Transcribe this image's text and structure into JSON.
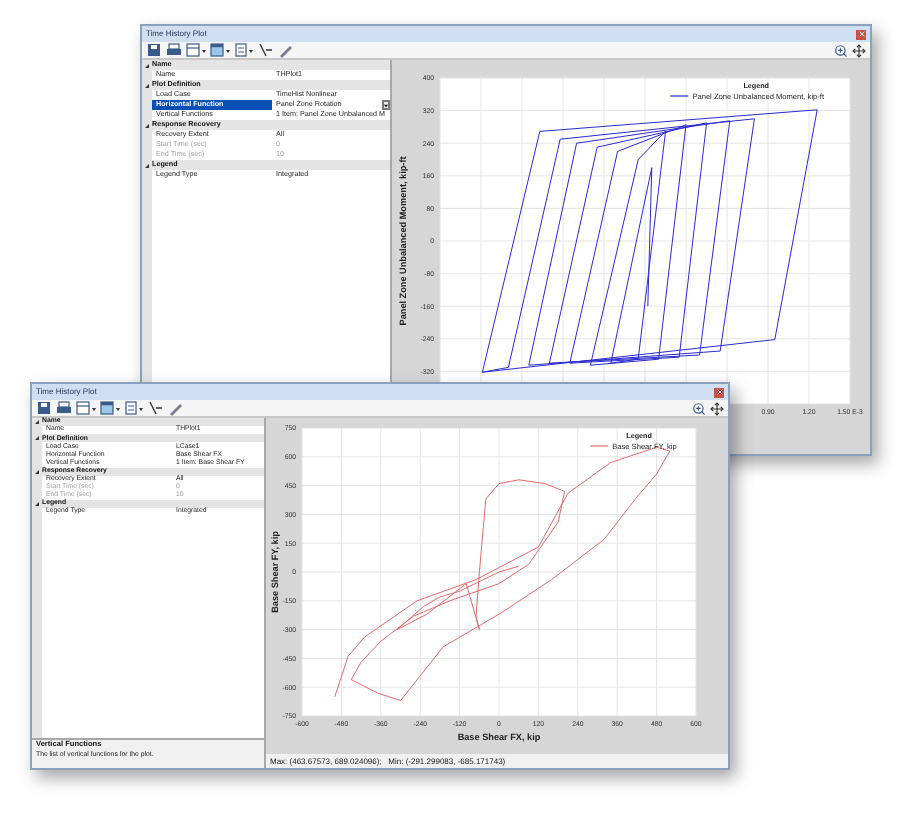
{
  "windows": [
    {
      "title": "Time History Plot",
      "properties": [
        {
          "title": "Name",
          "expanded": true,
          "items": [
            {
              "label": "Name",
              "value": "THPlot1",
              "disabled": false,
              "selected": false
            }
          ]
        },
        {
          "title": "Plot Definition",
          "expanded": true,
          "items": [
            {
              "label": "Load Case",
              "value": "TimeHist Nonlinear",
              "disabled": false,
              "selected": false
            },
            {
              "label": "Horizontal Function",
              "value": "Panel Zone Rotation",
              "disabled": false,
              "selected": true
            },
            {
              "label": "Vertical Functions",
              "value": "1 Item: Panel Zone Unbalanced M",
              "disabled": false,
              "selected": false
            }
          ]
        },
        {
          "title": "Response Recovery",
          "expanded": true,
          "items": [
            {
              "label": "Recovery Extent",
              "value": "All",
              "disabled": false,
              "selected": false
            },
            {
              "label": "Start Time (sec)",
              "value": "0",
              "disabled": true,
              "selected": false
            },
            {
              "label": "End Time (sec)",
              "value": "10",
              "disabled": true,
              "selected": false
            }
          ]
        },
        {
          "title": "Legend",
          "expanded": true,
          "items": [
            {
              "label": "Legend Type",
              "value": "Integrated",
              "disabled": false,
              "selected": false
            }
          ]
        }
      ],
      "plot": {
        "legend_title": "Legend",
        "chart_data": {
          "type": "line",
          "ylabel": "Panel Zone Unbalanced Moment, kip-ft",
          "x": [
            -1.19,
            -0.77,
            1.26,
            0.95,
            -1.19,
            -1.0,
            -0.62,
            0.8,
            0.55,
            -0.85,
            -0.5,
            0.62,
            0.4,
            -0.7,
            -0.35,
            0.45,
            0.25,
            -0.55,
            -0.2,
            0.3,
            0.1,
            -0.4,
            -0.05,
            0.15,
            -0.05,
            -0.25,
            0.05,
            0.02
          ],
          "series": [
            {
              "name": "Panel Zone Unbalanced Moment, kip-ft",
              "color": "#2a2ad0",
              "values": [
                -322,
                269,
                322,
                -242,
                -322,
                -310,
                250,
                300,
                -270,
                -305,
                240,
                295,
                -280,
                -300,
                230,
                290,
                -285,
                -300,
                220,
                285,
                -290,
                -305,
                200,
                270,
                -290,
                -300,
                180,
                -160
              ]
            }
          ],
          "xlim": [
            -1.5,
            1.5
          ],
          "ylim": [
            -400,
            400
          ],
          "grid": true,
          "xticks": [
            {
              "value": 0.9,
              "label": "0.90"
            },
            {
              "value": 1.2,
              "label": "1.20"
            },
            {
              "value": 1.5,
              "label": "1.50 E-3"
            }
          ],
          "yticks": [
            400,
            320,
            240,
            160,
            80,
            0,
            -80,
            -160,
            -240,
            -320
          ]
        }
      }
    },
    {
      "title": "Time History Plot",
      "properties": [
        {
          "title": "Name",
          "expanded": true,
          "items": [
            {
              "label": "Name",
              "value": "THPlot1",
              "disabled": false,
              "selected": false
            }
          ]
        },
        {
          "title": "Plot Definition",
          "expanded": true,
          "items": [
            {
              "label": "Load Case",
              "value": "LCase1",
              "disabled": false,
              "selected": false
            },
            {
              "label": "Horizontal Function",
              "value": "Base Shear FX",
              "disabled": false,
              "selected": false
            },
            {
              "label": "Vertical Functions",
              "value": "1 Item: Base Shear FY",
              "disabled": false,
              "selected": false
            }
          ]
        },
        {
          "title": "Response Recovery",
          "expanded": true,
          "items": [
            {
              "label": "Recovery Extent",
              "value": "All",
              "disabled": false,
              "selected": false
            },
            {
              "label": "Start Time (sec)",
              "value": "0",
              "disabled": true,
              "selected": false
            },
            {
              "label": "End Time (sec)",
              "value": "10",
              "disabled": true,
              "selected": false
            }
          ]
        },
        {
          "title": "Legend",
          "expanded": true,
          "items": [
            {
              "label": "Legend Type",
              "value": "Integrated",
              "disabled": false,
              "selected": false
            }
          ]
        }
      ],
      "description": {
        "title": "Vertical Functions",
        "text": "The list of vertical functions for the plot."
      },
      "plot": {
        "legend_title": "Legend",
        "status": "Max: (463.67573, 689.024096);   Min: (-291.299083, -685.171743)",
        "chart_data": {
          "type": "line",
          "xlabel": "Base Shear FX, kip",
          "ylabel": "Base Shear FY, kip",
          "x": [
            -500,
            -460,
            -410,
            -250,
            -70,
            120,
            210,
            340,
            480,
            520,
            480,
            420,
            320,
            160,
            0,
            -170,
            -300,
            -370,
            -450,
            -420,
            -360,
            -260,
            -150,
            0,
            90,
            180,
            200,
            140,
            60,
            0,
            -40,
            -60,
            -70,
            -60,
            -100,
            -220,
            -310,
            -230,
            -180,
            -120,
            0,
            60
          ],
          "series": [
            {
              "name": "Base Shear FY, kip",
              "color": "#e06a6a",
              "values": [
                -650,
                -440,
                -340,
                -150,
                -40,
                130,
                410,
                570,
                650,
                630,
                510,
                390,
                170,
                -40,
                -220,
                -390,
                -670,
                -630,
                -560,
                -470,
                -360,
                -230,
                -150,
                -60,
                40,
                260,
                420,
                460,
                480,
                460,
                380,
                0,
                -230,
                -300,
                -60,
                -220,
                -300,
                -180,
                -130,
                -100,
                0,
                30
              ]
            }
          ],
          "xlim": [
            -600,
            600
          ],
          "ylim": [
            -750,
            750
          ],
          "grid": true,
          "xticks": [
            -600,
            -480,
            -360,
            -240,
            -120,
            0,
            120,
            240,
            360,
            480,
            600
          ],
          "yticks": [
            750,
            600,
            450,
            300,
            150,
            0,
            -150,
            -300,
            -450,
            -600,
            -750
          ]
        }
      }
    }
  ]
}
